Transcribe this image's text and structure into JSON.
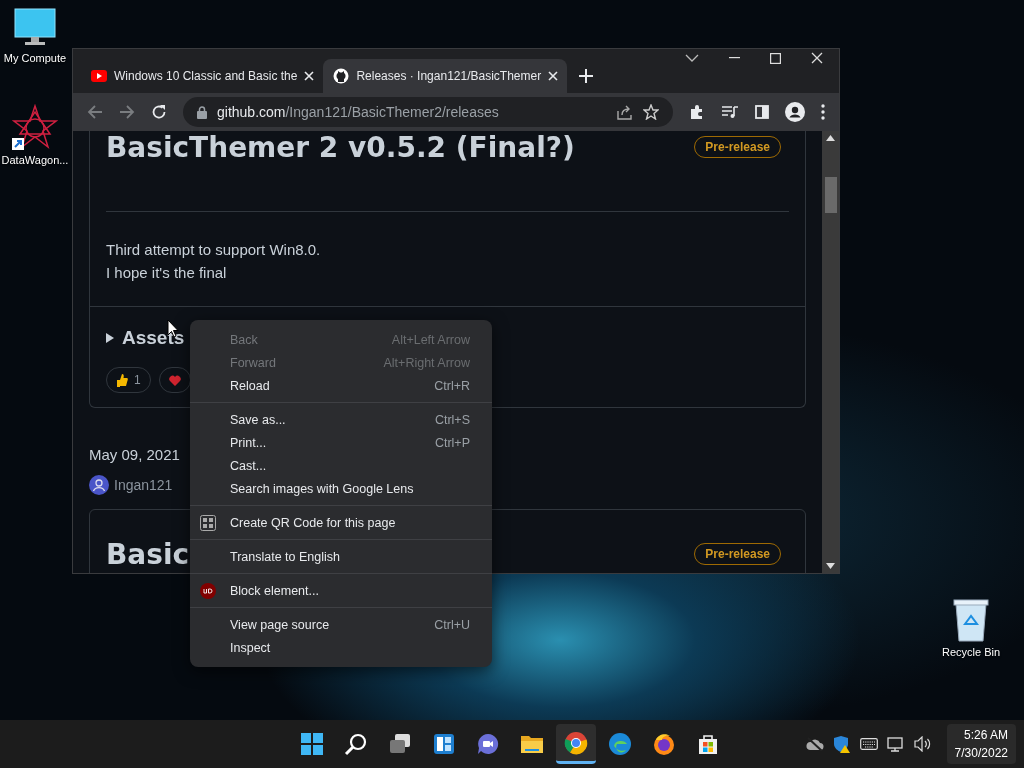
{
  "desktop": {
    "icons": [
      {
        "label": "My Compute",
        "kind": "computer"
      },
      {
        "label": "DataWagon...",
        "kind": "app"
      },
      {
        "label": "Recycle Bin",
        "kind": "bin"
      }
    ]
  },
  "browser": {
    "tabs": [
      {
        "title": "Windows 10 Classic and Basic the",
        "kind": "video",
        "selected": false
      },
      {
        "title": "Releases · Ingan121/BasicThemer",
        "kind": "repo",
        "selected": true
      }
    ],
    "address": {
      "domain": "github.com",
      "path": "/Ingan121/BasicThemer2/releases"
    }
  },
  "page": {
    "release": {
      "title": "BasicThemer 2 v0.5.2 (Final?)",
      "badge": "Pre-release",
      "notes": [
        "Third attempt to support Win8.0.",
        "I hope it's the final"
      ],
      "assets_label": "Assets",
      "assets_expanded": false,
      "reactions": [
        {
          "kind": "thumbs",
          "count": "1"
        },
        {
          "kind": "heart"
        }
      ]
    },
    "next": {
      "date": "May 09, 2021",
      "author": "Ingan121",
      "title_visible": "Basic",
      "badge": "Pre-release"
    }
  },
  "context_menu": {
    "groups": [
      [
        {
          "label": "Back",
          "shortcut": "Alt+Left Arrow",
          "disabled": true
        },
        {
          "label": "Forward",
          "shortcut": "Alt+Right Arrow",
          "disabled": true
        },
        {
          "label": "Reload",
          "shortcut": "Ctrl+R",
          "disabled": false
        }
      ],
      [
        {
          "label": "Save as...",
          "shortcut": "Ctrl+S",
          "disabled": false
        },
        {
          "label": "Print...",
          "shortcut": "Ctrl+P",
          "disabled": false
        },
        {
          "label": "Cast...",
          "disabled": false
        },
        {
          "label": "Search images with Google Lens",
          "disabled": false
        }
      ],
      [
        {
          "label": "Create QR Code for this page",
          "kind": "qr",
          "disabled": false
        }
      ],
      [
        {
          "label": "Translate to English",
          "disabled": false
        }
      ],
      [
        {
          "label": "Block element...",
          "kind": "blocker",
          "disabled": false
        }
      ],
      [
        {
          "label": "View page source",
          "shortcut": "Ctrl+U",
          "disabled": false
        },
        {
          "label": "Inspect",
          "disabled": false
        }
      ]
    ]
  },
  "taskbar": {
    "apps": [
      {
        "kind": "start",
        "selected": false
      },
      {
        "kind": "search",
        "selected": false
      },
      {
        "kind": "taskview",
        "selected": false
      },
      {
        "kind": "widgets",
        "selected": false
      },
      {
        "kind": "chat",
        "selected": false
      },
      {
        "kind": "explorer",
        "selected": false
      },
      {
        "kind": "chrome",
        "selected": true
      },
      {
        "kind": "edge",
        "selected": false
      },
      {
        "kind": "firefox",
        "selected": false
      },
      {
        "kind": "store",
        "selected": false
      }
    ],
    "clock": {
      "time": "5:26 AM",
      "date": "7/30/2022"
    }
  }
}
